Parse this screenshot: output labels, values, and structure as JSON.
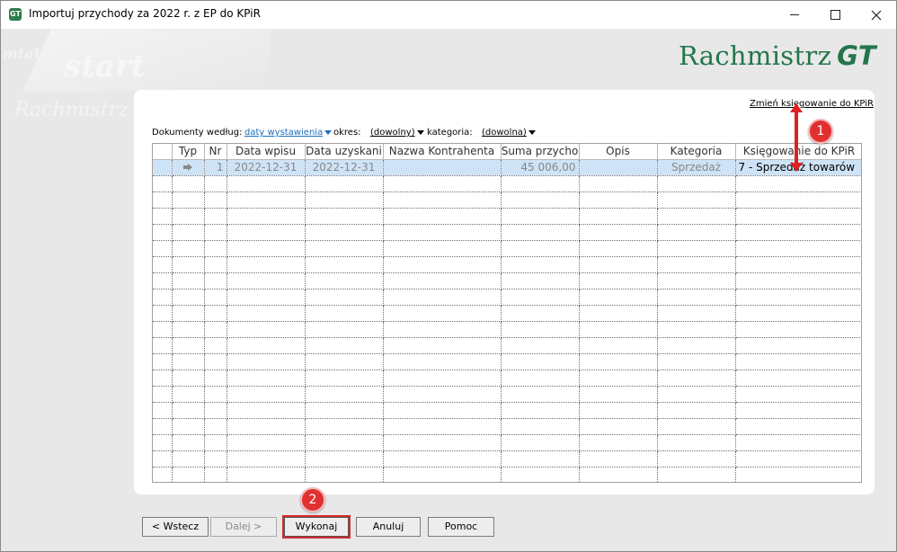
{
  "window": {
    "title": "Importuj przychody za 2022 r. z EP do KPiR",
    "icon": "gt-app-icon"
  },
  "background": {
    "deco_words": [
      "mtatwy",
      "start",
      "Rachmistrz"
    ]
  },
  "brand": {
    "name": "Rachmistrz",
    "suffix": "GT",
    "color": "#24764a"
  },
  "panel": {
    "change_link": "Zmień księgowanie do KPiR",
    "filters": {
      "label_documents": "Dokumenty według:",
      "documents_value": "daty wystawienia",
      "label_period": "okres:",
      "period_value": "(dowolny)",
      "label_category": "kategoria:",
      "category_value": "(dowolna)"
    },
    "table": {
      "columns": [
        "",
        "Typ",
        "Nr",
        "Data wpisu",
        "Data uzyskani",
        "Nazwa Kontrahenta",
        "Suma przycho",
        "Opis",
        "Kategoria",
        "Księgowanie do KPiR"
      ],
      "rows": [
        {
          "type_icon": "arrow-right-icon",
          "nr": "1",
          "data_wpisu": "2022-12-31",
          "data_uzyskania": "2022-12-31",
          "kontrahent": "",
          "suma": "45 006,00",
          "opis": "",
          "kategoria": "Sprzedaż",
          "ksiegowanie": "7 - Sprzedaż towarów"
        }
      ],
      "empty_row_count": 19,
      "selected_row_color": "#cfe3f7"
    }
  },
  "annotations": {
    "badge1": "1",
    "badge2": "2",
    "color": "#e03030"
  },
  "buttons": {
    "back": "< Wstecz",
    "next": "Dalej >",
    "run": "Wykonaj",
    "cancel": "Anuluj",
    "help": "Pomoc"
  }
}
